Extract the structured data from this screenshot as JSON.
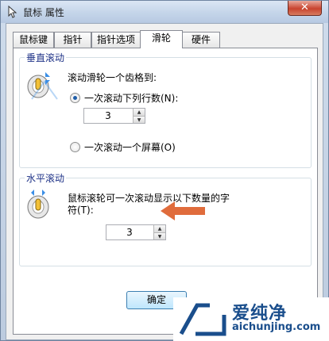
{
  "window": {
    "title": "鼠标 属性",
    "close_label": "✕",
    "ok_label": "确定"
  },
  "tabs": [
    {
      "label": "鼠标键"
    },
    {
      "label": "指针"
    },
    {
      "label": "指针选项"
    },
    {
      "label": "滑轮",
      "active": true
    },
    {
      "label": "硬件"
    }
  ],
  "vertical_scroll": {
    "title": "垂直滚动",
    "description": "滚动滑轮一个齿格到:",
    "option_lines_label": "一次滚动下列行数(N):",
    "option_lines_checked": true,
    "lines_value": "3",
    "option_screen_label": "一次滚动一个屏幕(O)",
    "option_screen_checked": false
  },
  "horizontal_scroll": {
    "title": "水平滚动",
    "description_line1": "鼠标滚轮可一次滚动显示以下数量的字",
    "description_line2": "符(T):",
    "chars_value": "3"
  },
  "watermark": {
    "brand_cn": "爱纯净",
    "brand_url": "aichunjing.com"
  },
  "colors": {
    "group_title": "#1e3287",
    "arrow": "#e06c3c",
    "watermark": "#1a4e8c"
  }
}
